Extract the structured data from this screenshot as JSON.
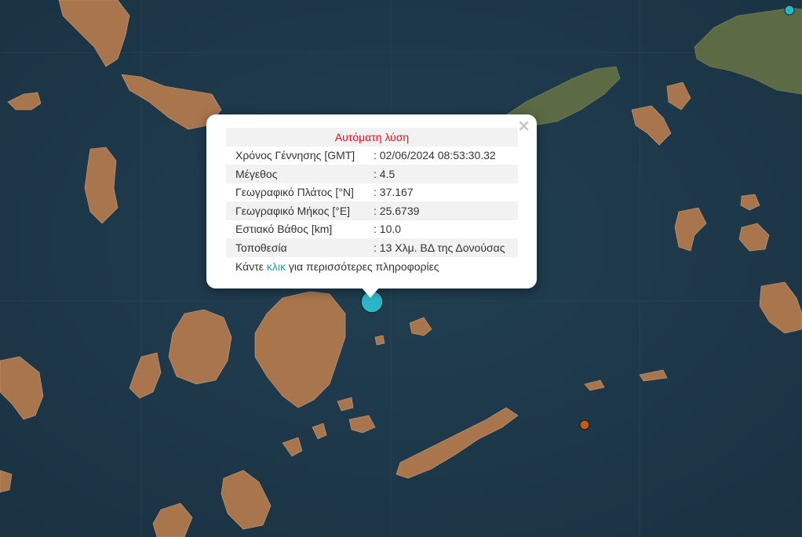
{
  "popup": {
    "title": "Αυτόματη λύση",
    "close_icon": "×",
    "rows": [
      {
        "label": "Χρόνος Γέννησης [GMT]",
        "value": ": 02/06/2024 08:53:30.32"
      },
      {
        "label": "Μέγεθος",
        "value": ": 4.5"
      },
      {
        "label": "Γεωγραφικό Πλάτος [°N]",
        "value": ": 37.167"
      },
      {
        "label": "Γεωγραφικό Μήκος [°E]",
        "value": ": 25.6739"
      },
      {
        "label": "Εστιακό Βάθος [km]",
        "value": ": 10.0"
      },
      {
        "label": "Τοποθεσία",
        "value": ": 13 Χλμ. ΒΔ της Δονούσας"
      }
    ],
    "more_prefix": "Κάντε ",
    "more_link": "κλικ",
    "more_suffix": " για περισσότερες πληροφορίες"
  },
  "markers": [
    {
      "name": "marker-selected",
      "color": "#2cb5c5"
    },
    {
      "name": "marker-top-right",
      "color": "#2cb5c5"
    },
    {
      "name": "marker-orange",
      "color": "#c55a11"
    }
  ],
  "colors": {
    "sea": "#1f3a4c",
    "land": "#a9754d",
    "land_green": "#5c6b44",
    "header": "#e8141a",
    "link": "#1a9fbf"
  }
}
